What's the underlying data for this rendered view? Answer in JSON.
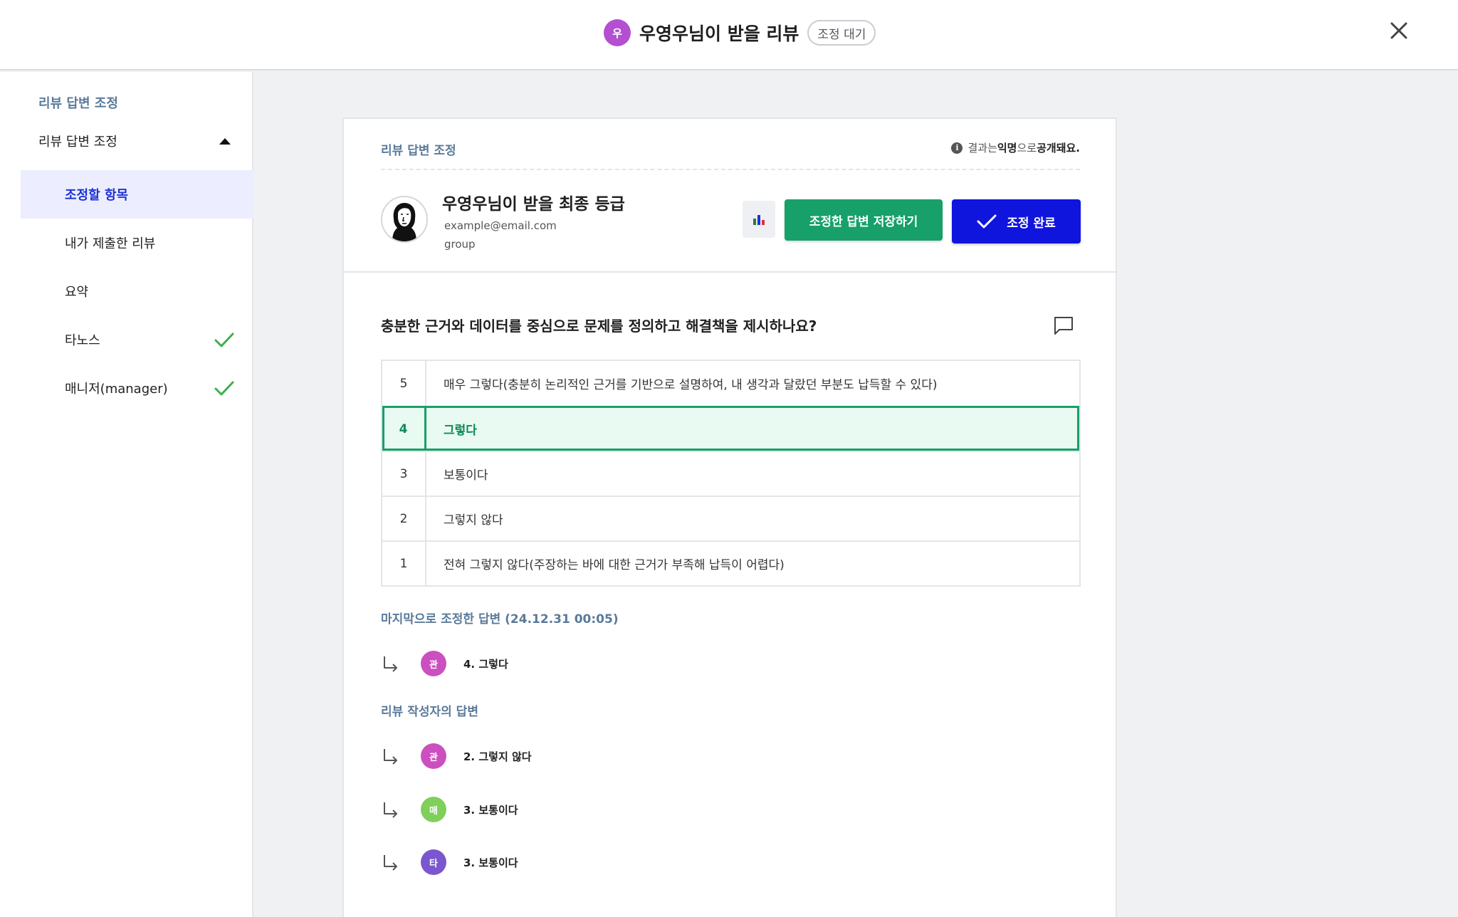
{
  "header": {
    "avatar_initial": "우",
    "title": "우영우님이 받을 리뷰",
    "status": "조정 대기"
  },
  "sidebar": {
    "heading": "리뷰 답변 조정",
    "group_label": "리뷰 답변 조정",
    "items": [
      {
        "label": "조정할 항목",
        "active": true,
        "done": false
      },
      {
        "label": "내가 제출한 리뷰",
        "active": false,
        "done": false
      },
      {
        "label": "요약",
        "active": false,
        "done": false
      },
      {
        "label": "타노스",
        "active": false,
        "done": true
      },
      {
        "label": "매니저(manager)",
        "active": false,
        "done": true
      }
    ]
  },
  "card": {
    "label": "리뷰 답변 조정",
    "note_prefix": "결과는 ",
    "note_bold1": "익명",
    "note_mid": "으로 ",
    "note_bold2": "공개돼요."
  },
  "profile": {
    "name": "우영우님이 받을 최종 등급",
    "email": "example@email.com",
    "group": "group"
  },
  "actions": {
    "save_label": "조정한 답변 저장하기",
    "done_label": "조정 완료"
  },
  "question": {
    "text": "충분한 근거와 데이터를 중심으로 문제를 정의하고 해결책을 제시하나요?",
    "options": [
      {
        "num": "5",
        "text": "매우 그렇다(충분히 논리적인 근거를 기반으로 설명하여, 내 생각과 달랐던 부분도 납득할 수 있다)"
      },
      {
        "num": "4",
        "text": "그렇다"
      },
      {
        "num": "3",
        "text": "보통이다"
      },
      {
        "num": "2",
        "text": "그렇지 않다"
      },
      {
        "num": "1",
        "text": "전혀 그렇지 않다(주장하는 바에 대한 근거가 부족해 납득이 어렵다)"
      }
    ],
    "selected": "4"
  },
  "last_adjusted": {
    "label": "마지막으로 조정한 답변 (24.12.31 00:05)",
    "answers": [
      {
        "initial": "관",
        "text": "4. 그렇다",
        "color": "#cc4fbf"
      }
    ]
  },
  "reviewer_answers": {
    "label": "리뷰 작성자의 답변",
    "answers": [
      {
        "initial": "관",
        "text": "2. 그렇지 않다",
        "color": "#cc4fbf"
      },
      {
        "initial": "매",
        "text": "3. 보통이다",
        "color": "#7fcf5a"
      },
      {
        "initial": "타",
        "text": "3. 보통이다",
        "color": "#7a57cf"
      }
    ]
  },
  "colors": {
    "accent_green": "#17a06a",
    "accent_blue": "#0f15dd",
    "section_label": "#5a7a9b"
  }
}
